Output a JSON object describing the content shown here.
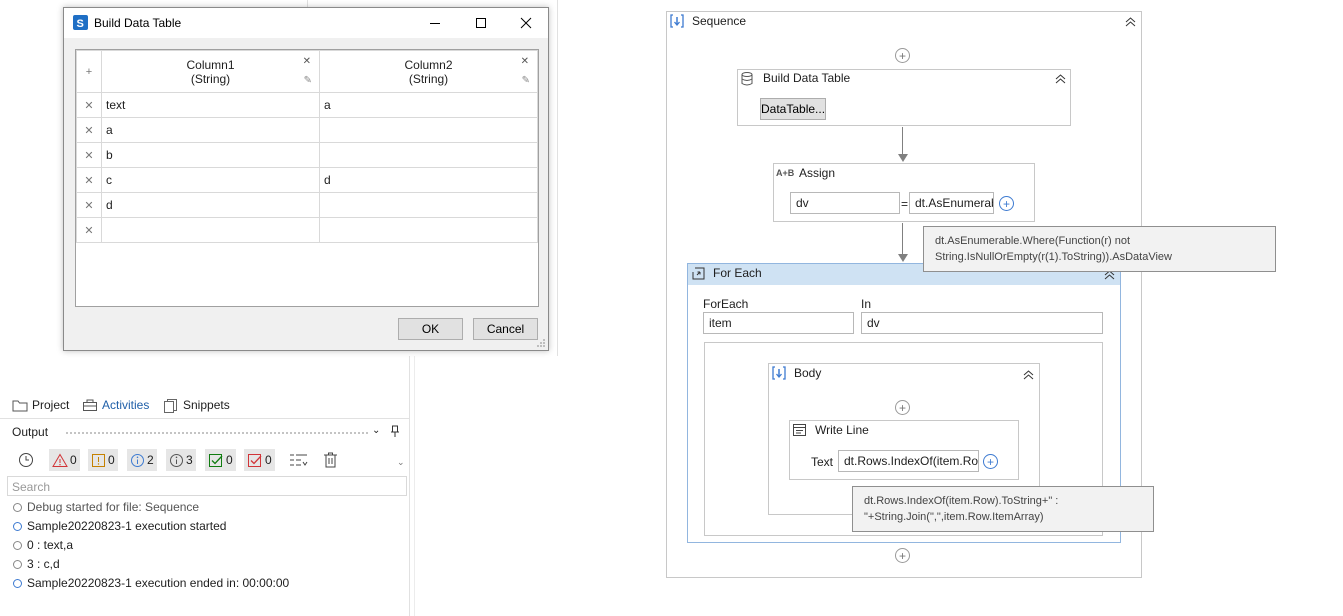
{
  "dialog": {
    "title": "Build Data Table",
    "columns": [
      {
        "name": "Column1",
        "type": "(String)"
      },
      {
        "name": "Column2",
        "type": "(String)"
      }
    ],
    "rows": [
      [
        "text",
        "a"
      ],
      [
        "a",
        ""
      ],
      [
        "b",
        ""
      ],
      [
        "c",
        "d"
      ],
      [
        "d",
        ""
      ],
      [
        "",
        ""
      ]
    ],
    "ok_label": "OK",
    "cancel_label": "Cancel"
  },
  "panel_tabs": {
    "project": "Project",
    "activities": "Activities",
    "snippets": "Snippets"
  },
  "output": {
    "title": "Output",
    "counts": {
      "errors": "0",
      "warnings": "0",
      "info": "2",
      "trace": "3",
      "success": "0",
      "failed": "0"
    },
    "search_placeholder": "Search",
    "log": [
      "Debug started for file: Sequence",
      "Sample20220823-1 execution started",
      "0 : text,a",
      "3 : c,d",
      "Sample20220823-1 execution ended in: 00:00:00"
    ]
  },
  "designer": {
    "sequence_title": "Sequence",
    "build_dt": {
      "title": "Build Data Table",
      "button": "DataTable..."
    },
    "assign": {
      "title": "Assign",
      "to": "dv",
      "eq": "=",
      "value": "dt.AsEnumerabl"
    },
    "assign_tooltip": "dt.AsEnumerable.Where(Function(r) not String.IsNullOrEmpty(r(1).ToString)).AsDataView",
    "foreach": {
      "title": "For Each",
      "foreach_label": "ForEach",
      "in_label": "In",
      "item": "item",
      "in_value": "dv"
    },
    "body_title": "Body",
    "writeline": {
      "title": "Write Line",
      "text_label": "Text",
      "text_value": "dt.Rows.IndexOf(item.Ro"
    },
    "writeline_tooltip": "dt.Rows.IndexOf(item.Row).ToString+\" : \"+String.Join(\",\",item.Row.ItemArray)"
  },
  "colors": {
    "accent": "#3e7bd1",
    "foreach_header": "#cfe2f3",
    "error": "#d13438",
    "success": "#107c10"
  }
}
